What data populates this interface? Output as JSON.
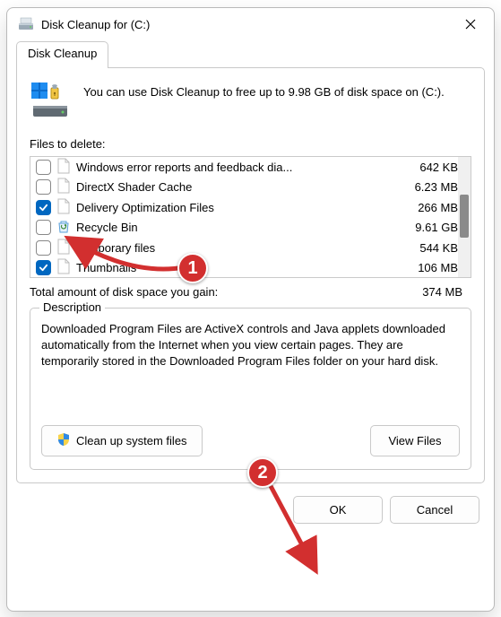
{
  "window": {
    "title": "Disk Cleanup for  (C:)"
  },
  "tab": {
    "label": "Disk Cleanup"
  },
  "intro": "You can use Disk Cleanup to free up to 9.98 GB of disk space on  (C:).",
  "files_label": "Files to delete:",
  "files": [
    {
      "name": "Windows error reports and feedback dia...",
      "size": "642 KB",
      "checked": false,
      "icon": "file"
    },
    {
      "name": "DirectX Shader Cache",
      "size": "6.23 MB",
      "checked": false,
      "icon": "file"
    },
    {
      "name": "Delivery Optimization Files",
      "size": "266 MB",
      "checked": true,
      "icon": "file"
    },
    {
      "name": "Recycle Bin",
      "size": "9.61 GB",
      "checked": false,
      "icon": "recycle"
    },
    {
      "name": "Temporary files",
      "size": "544 KB",
      "checked": false,
      "icon": "file"
    },
    {
      "name": "Thumbnails",
      "size": "106 MB",
      "checked": true,
      "icon": "file"
    }
  ],
  "total": {
    "label": "Total amount of disk space you gain:",
    "value": "374 MB"
  },
  "description": {
    "legend": "Description",
    "text": "Downloaded Program Files are ActiveX controls and Java applets downloaded automatically from the Internet when you view certain pages. They are temporarily stored in the Downloaded Program Files folder on your hard disk."
  },
  "buttons": {
    "cleanup": "Clean up system files",
    "view": "View Files",
    "ok": "OK",
    "cancel": "Cancel"
  },
  "annotations": {
    "one": "1",
    "two": "2"
  }
}
